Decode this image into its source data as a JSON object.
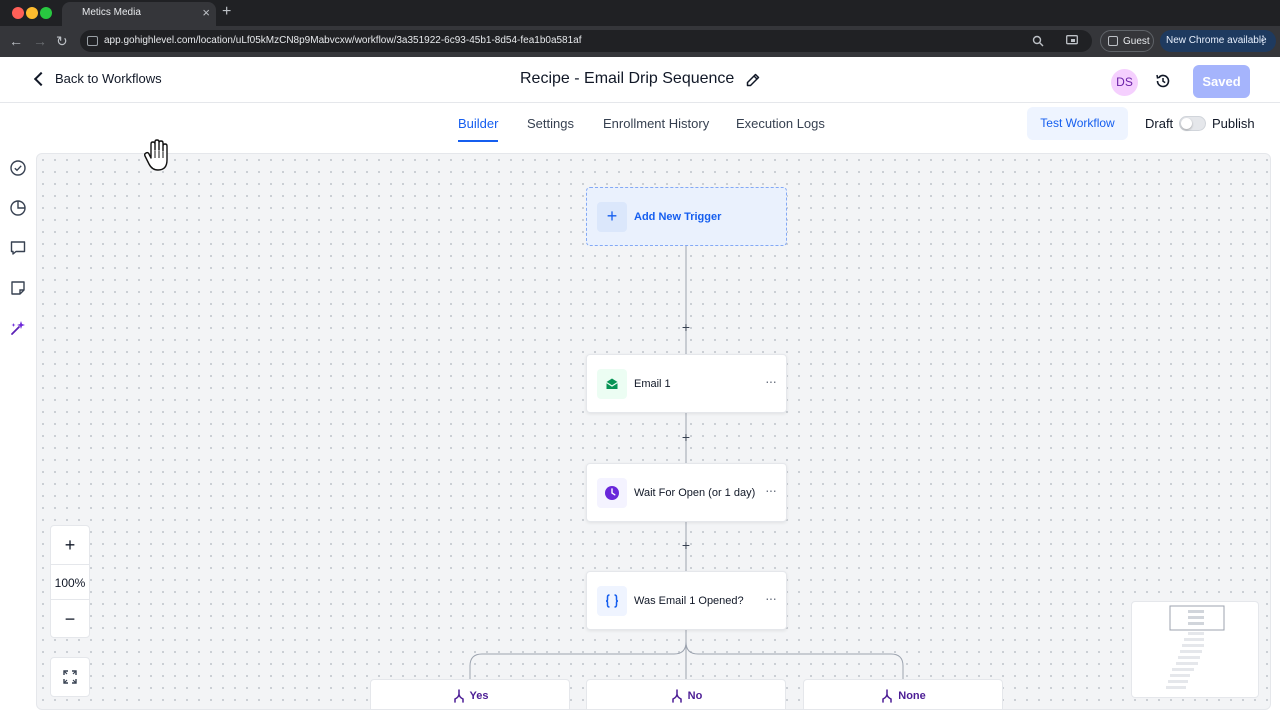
{
  "browser": {
    "tab_title": "Metics Media",
    "url": "app.gohighlevel.com/location/uLf05kMzCN8p9Mabvcxw/workflow/3a351922-6c93-45b1-8d54-fea1b0a581af",
    "profile_label": "Guest",
    "update_label": "New Chrome available"
  },
  "header": {
    "back_label": "Back to Workflows",
    "title": "Recipe - Email Drip Sequence",
    "avatar_initials": "DS",
    "saved_label": "Saved"
  },
  "tabs": [
    {
      "label": "Builder",
      "active": true
    },
    {
      "label": "Settings",
      "active": false
    },
    {
      "label": "Enrollment History",
      "active": false
    },
    {
      "label": "Execution Logs",
      "active": false
    }
  ],
  "actions": {
    "test_label": "Test Workflow",
    "draft_label": "Draft",
    "publish_label": "Publish",
    "published": false
  },
  "rail_icons": [
    "check-circle-icon",
    "pie-chart-icon",
    "comment-icon",
    "note-icon",
    "sparkles-icon"
  ],
  "canvas": {
    "trigger_label": "Add New Trigger",
    "nodes": [
      {
        "label": "Email 1",
        "icon": "email-icon"
      },
      {
        "label": "Wait For Open (or 1 day)",
        "icon": "clock-icon"
      },
      {
        "label": "Was Email 1 Opened?",
        "icon": "braces-icon"
      }
    ],
    "branches": [
      "Yes",
      "No",
      "None"
    ],
    "zoom_level": "100%"
  },
  "colors": {
    "accent": "#155eef",
    "saved_button": "#a5b4fc",
    "email_green": "#079455",
    "wait_purple": "#6927da",
    "branch_purple": "#4c1d95"
  }
}
